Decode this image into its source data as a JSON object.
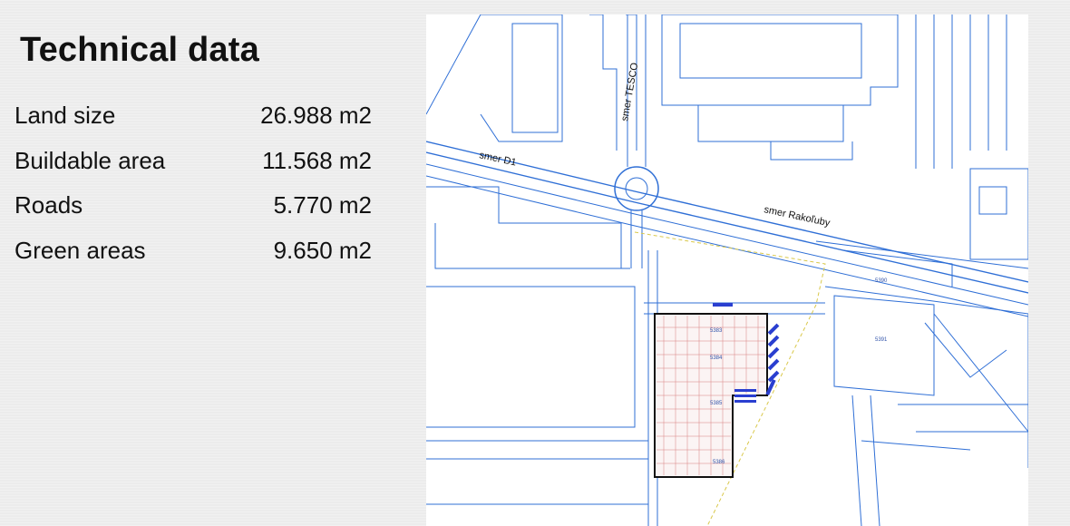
{
  "title": "Technical data",
  "rows": [
    {
      "label": "Land size",
      "value": "26.988 m2"
    },
    {
      "label": "Buildable area",
      "value": "11.568 m2"
    },
    {
      "label": "Roads",
      "value": "5.770 m2"
    },
    {
      "label": "Green areas",
      "value": "9.650 m2"
    }
  ],
  "map": {
    "road_labels": [
      "smer TESCO",
      "smer D1",
      "smer Rakoľuby"
    ],
    "parcels": [
      "5383",
      "5384",
      "5385",
      "5386",
      "5390",
      "5391"
    ],
    "line_color": "#2f6fd6",
    "plot_border_color": "#111111",
    "grid_color": "#d98080",
    "accent_color": "#2a3fd0"
  }
}
